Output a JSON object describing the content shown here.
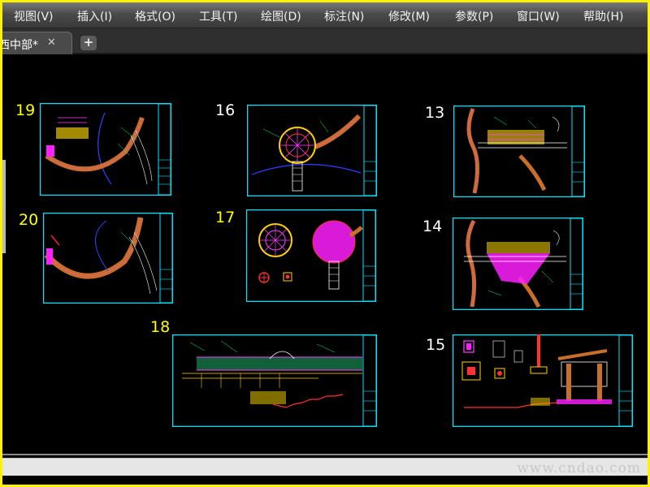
{
  "menu": {
    "items": [
      "视图(V)",
      "插入(I)",
      "格式(O)",
      "工具(T)",
      "绘图(D)",
      "标注(N)",
      "修改(M)",
      "参数(P)",
      "窗口(W)",
      "帮助(H)"
    ]
  },
  "tabs": {
    "active_label": "西中部*",
    "close_glyph": "✕",
    "new_glyph": "+"
  },
  "sheets": {
    "numbers": [
      "19",
      "16",
      "13",
      "20",
      "17",
      "14",
      "18",
      "15"
    ],
    "number_colors": {
      "yellow": "#ffff00",
      "white": "#ffffff"
    },
    "frame_color": "#00e5ff"
  },
  "watermark": "www.cndao.com"
}
